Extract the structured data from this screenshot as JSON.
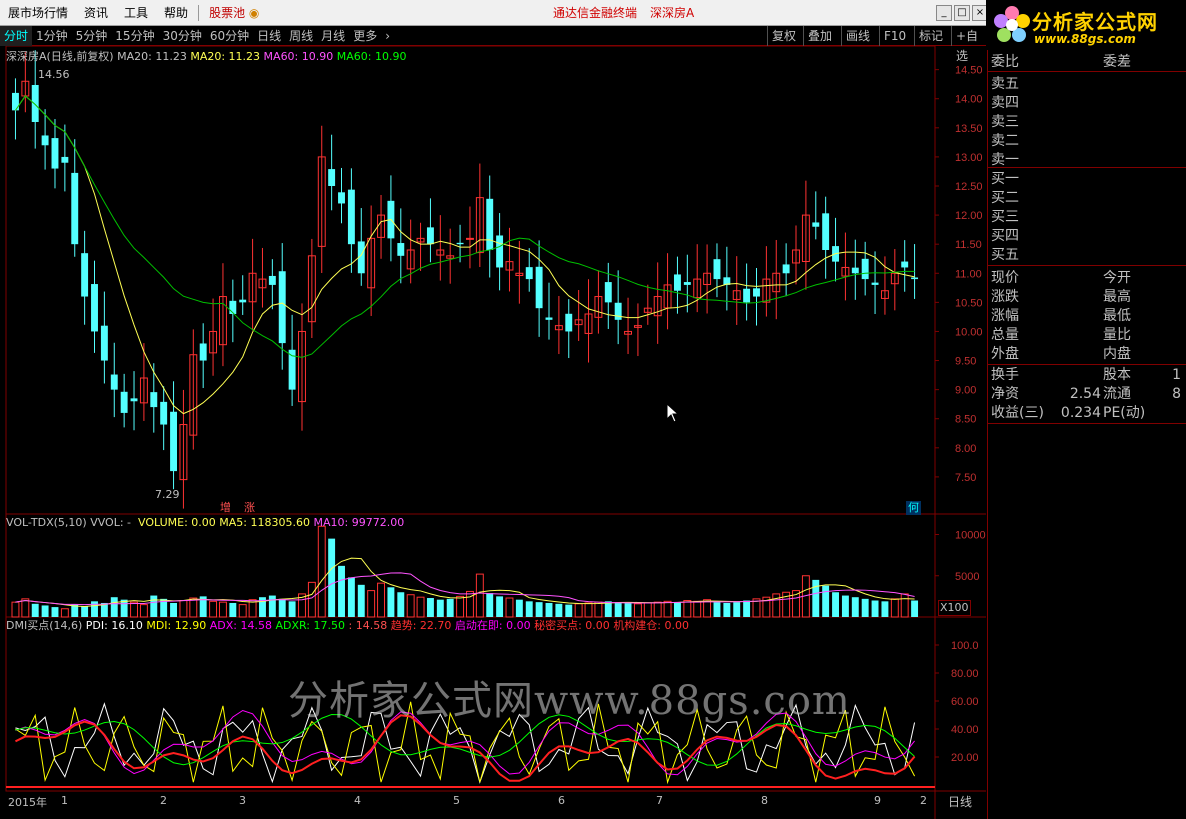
{
  "menubar": {
    "items": [
      "展市场行情",
      "资讯",
      "工具",
      "帮助"
    ],
    "stock_pool": "股票池",
    "terminal_title": "通达信金融终端",
    "stock_name": "深深房A"
  },
  "logo": {
    "text": "分析家公式网",
    "url": "www.88gs.com"
  },
  "tabs": [
    "分时",
    "1分钟",
    "5分钟",
    "15分钟",
    "30分钟",
    "60分钟",
    "日线",
    "周线",
    "月线",
    "更多"
  ],
  "tab_active": 0,
  "right_buttons": [
    "复权",
    "叠加",
    "画线",
    "F10",
    "标记",
    "+自选"
  ],
  "price_legend": {
    "name": "深深房A(日线,前复权)",
    "ma20a": "MA20: 11.23",
    "ma20b": "MA20: 11.23",
    "ma60a": "MA60: 10.90",
    "ma60b": "MA60: 10.90"
  },
  "vol_legend": {
    "name": "VOL-TDX(5,10)",
    "vvol": "VVOL: -",
    "volume": "VOLUME: 0.00",
    "ma5": "MA5: 118305.60",
    "ma10": "MA10: 99772.00"
  },
  "dmi_legend": {
    "name": "DMI买点(14,6)",
    "pdi": "PDI: 16.10",
    "mdi": "MDI: 12.90",
    "adx": "ADX: 14.58",
    "adxr": "ADXR: 17.50",
    "v1": ": 14.58",
    "trend": "趋势: 22.70",
    "start": "启动在即: 0.00",
    "secret": "秘密买点: 0.00",
    "inst": "机构建仓: 0.00"
  },
  "price_annotations": {
    "high": "14.56",
    "low": "7.29",
    "tag1": "增",
    "tag2": "涨",
    "tag3": "何"
  },
  "vol_unit": "X100",
  "x_axis": {
    "year": "2015年",
    "months": [
      "1",
      "2",
      "3",
      "4",
      "5",
      "6",
      "7",
      "8",
      "9",
      "2"
    ],
    "period": "日线"
  },
  "watermark": "分析家公式网www.88gs.com",
  "side_panel": {
    "rows": [
      {
        "l1": "委比",
        "l2": "委差"
      },
      {
        "l1": "卖五"
      },
      {
        "l1": "卖四"
      },
      {
        "l1": "卖三"
      },
      {
        "l1": "卖二"
      },
      {
        "l1": "卖一"
      },
      {
        "l1": "买一"
      },
      {
        "l1": "买二"
      },
      {
        "l1": "买三"
      },
      {
        "l1": "买四"
      },
      {
        "l1": "买五"
      },
      {
        "l1": "现价",
        "l2": "今开"
      },
      {
        "l1": "涨跌",
        "l2": "最高"
      },
      {
        "l1": "涨幅",
        "l2": "最低"
      },
      {
        "l1": "总量",
        "l2": "量比"
      },
      {
        "l1": "外盘",
        "l2": "内盘"
      },
      {
        "l1": "换手",
        "l2": "股本",
        "v2": "1"
      },
      {
        "l1": "净资",
        "v1": "2.54",
        "l2": "流通",
        "v2": "8"
      },
      {
        "l1": "收益(三)",
        "v1": "0.234",
        "l2": "PE(动)"
      }
    ]
  },
  "colors": {
    "up": "#ff3232",
    "down": "#54ffff",
    "ma20": "#ffff54",
    "ma60": "#00c000",
    "pdi": "#ffffff",
    "mdi": "#ffff00",
    "adx": "#ff00ff",
    "adxr": "#00ff00",
    "grid": "#800000"
  },
  "chart_data": [
    {
      "type": "candlestick",
      "title": "深深房A(日线,前复权)",
      "ylim": [
        7.0,
        14.7
      ],
      "yticks": [
        7.5,
        8.0,
        8.5,
        9.0,
        9.5,
        10.0,
        10.5,
        11.0,
        11.5,
        12.0,
        12.5,
        13.0,
        13.5,
        14.0,
        14.5
      ],
      "close_approx": [
        13.8,
        14.3,
        13.6,
        13.2,
        12.8,
        12.9,
        11.5,
        10.6,
        10.0,
        9.5,
        9.0,
        8.6,
        8.8,
        9.2,
        8.7,
        8.4,
        7.6,
        8.4,
        9.6,
        9.5,
        10.0,
        10.6,
        10.3,
        10.5,
        11.0,
        10.9,
        10.8,
        9.8,
        9.0,
        10.0,
        11.3,
        13.0,
        12.5,
        12.2,
        11.5,
        11.0,
        11.6,
        12.0,
        11.6,
        11.3,
        11.4,
        11.6,
        11.5,
        11.4,
        11.3,
        11.5,
        11.6,
        12.3,
        11.4,
        11.1,
        11.2,
        11.0,
        10.9,
        10.4,
        10.2,
        10.1,
        10.0,
        10.2,
        10.3,
        10.6,
        10.5,
        10.2,
        10.0,
        10.1,
        10.4,
        10.6,
        10.8,
        10.7,
        10.8,
        10.9,
        11.0,
        10.9,
        10.8,
        10.7,
        10.5,
        10.6,
        10.9,
        11.0,
        11.0,
        11.4,
        12.0,
        11.8,
        11.4,
        11.2,
        11.1,
        11.0,
        10.9,
        10.8,
        10.7,
        11.0,
        11.1,
        10.9
      ],
      "ma20": "MA20: 11.23",
      "ma60": "MA60: 10.90",
      "annotations": {
        "high": "14.56",
        "low": "7.29"
      }
    },
    {
      "type": "bar",
      "title": "VOL-TDX(5,10)",
      "ylim": [
        0,
        12000
      ],
      "yticks": [
        5000,
        10000
      ],
      "unit": "X100",
      "values_approx": [
        1800,
        2200,
        1600,
        1400,
        1200,
        1000,
        1500,
        1300,
        1900,
        1700,
        2400,
        2100,
        1800,
        1500,
        2600,
        2200,
        1700,
        2000,
        2300,
        2500,
        1900,
        1800,
        1700,
        1500,
        2100,
        2400,
        2600,
        2200,
        1900,
        2800,
        4200,
        11000,
        9500,
        6200,
        4800,
        3900,
        3200,
        4100,
        3600,
        3000,
        2700,
        2400,
        2300,
        2100,
        2200,
        2500,
        3100,
        5200,
        2900,
        2500,
        2300,
        2100,
        1900,
        1800,
        1700,
        1600,
        1500,
        1600,
        1700,
        1800,
        1900,
        1800,
        1700,
        1600,
        1700,
        1800,
        1900,
        1800,
        2000,
        1900,
        2100,
        1800,
        1700,
        1800,
        2000,
        2200,
        2400,
        2800,
        3000,
        3200,
        5000,
        4500,
        3800,
        3000,
        2600,
        2400,
        2200,
        2000,
        1900,
        2200,
        2800,
        2000
      ],
      "ma5": "MA5: 118305.60",
      "ma10": "MA10: 99772.00"
    },
    {
      "type": "line",
      "title": "DMI买点(14,6)",
      "ylim": [
        0,
        110
      ],
      "yticks": [
        20.0,
        40.0,
        60.0,
        80.0,
        100.0
      ],
      "series": [
        {
          "name": "PDI",
          "value": "16.10"
        },
        {
          "name": "MDI",
          "value": "12.90"
        },
        {
          "name": "ADX",
          "value": "14.58"
        },
        {
          "name": "ADXR",
          "value": "17.50"
        },
        {
          "name": "趋势",
          "value": "22.70"
        }
      ]
    }
  ]
}
